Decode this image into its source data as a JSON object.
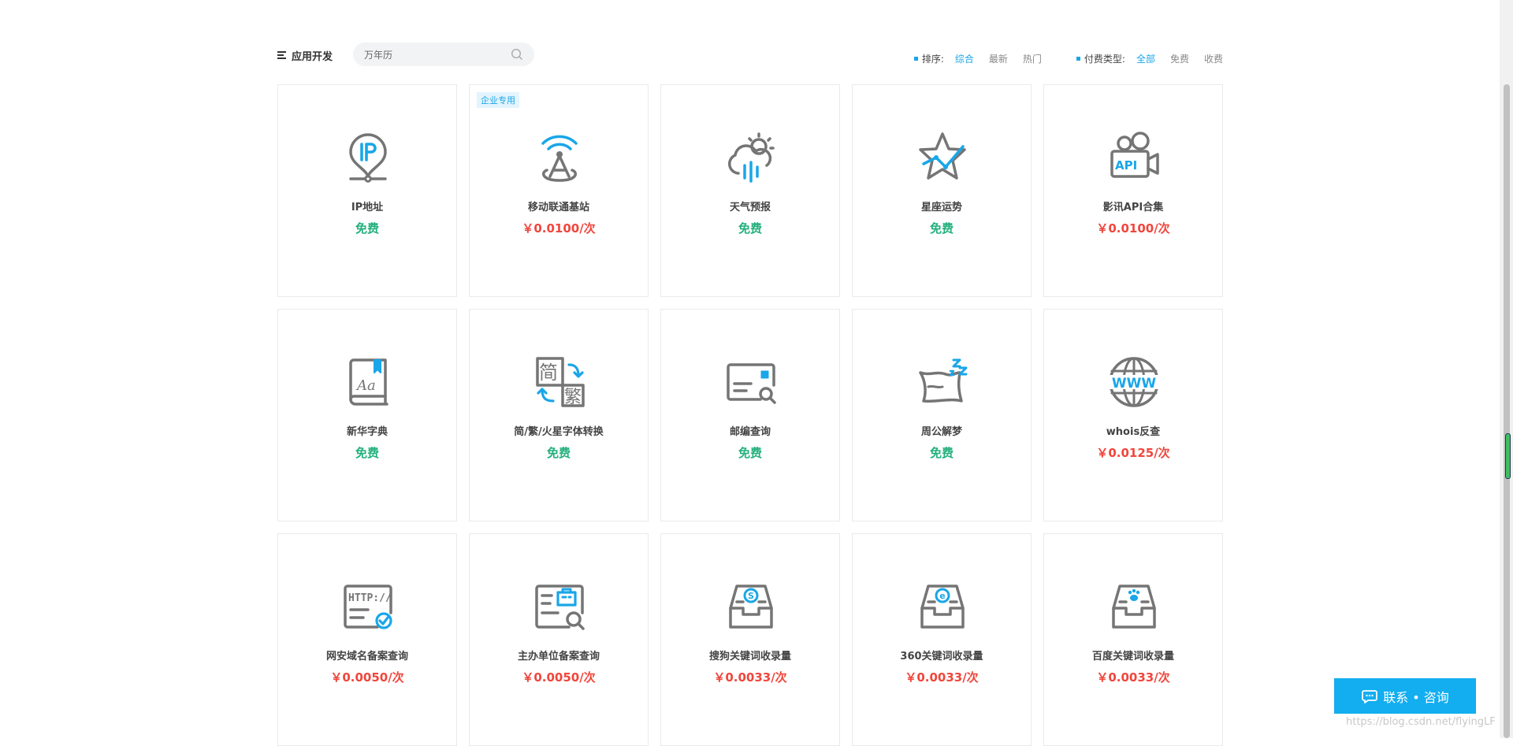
{
  "header": {
    "category_label": "应用开发",
    "search_value": "万年历",
    "sort_label": "排序:",
    "sort_options": [
      "综合",
      "最新",
      "热门"
    ],
    "pay_label": "付费类型:",
    "pay_options": [
      "全部",
      "免费",
      "收费"
    ]
  },
  "colors": {
    "accent": "#1aa6e8",
    "free": "#22b07d",
    "paid": "#f0463c",
    "icon_gray": "#757575"
  },
  "cards": [
    {
      "name": "IP地址",
      "price": "免费",
      "icon": "ip-location-icon"
    },
    {
      "name": "移动联通基站",
      "price": "￥0.0100/次",
      "badge": "企业专用",
      "icon": "base-station-icon"
    },
    {
      "name": "天气预报",
      "price": "免费",
      "icon": "weather-icon"
    },
    {
      "name": "星座运势",
      "price": "免费",
      "icon": "star-trend-icon"
    },
    {
      "name": "影讯API合集",
      "price": "￥0.0100/次",
      "icon": "camera-api-icon"
    },
    {
      "name": "新华字典",
      "price": "免费",
      "icon": "dictionary-icon"
    },
    {
      "name": "简/繁/火星字体转换",
      "price": "免费",
      "icon": "text-convert-icon"
    },
    {
      "name": "邮编查询",
      "price": "免费",
      "icon": "postcode-search-icon"
    },
    {
      "name": "周公解梦",
      "price": "免费",
      "icon": "pillow-dream-icon"
    },
    {
      "name": "whois反查",
      "price": "￥0.0125/次",
      "icon": "www-globe-icon"
    },
    {
      "name": "网安域名备案查询",
      "price": "￥0.0050/次",
      "icon": "http-check-icon"
    },
    {
      "name": "主办单位备案查询",
      "price": "￥0.0050/次",
      "icon": "organization-search-icon"
    },
    {
      "name": "搜狗关键词收录量",
      "price": "￥0.0033/次",
      "icon": "sogou-tray-icon"
    },
    {
      "name": "360关键词收录量",
      "price": "￥0.0033/次",
      "icon": "360-tray-icon"
    },
    {
      "name": "百度关键词收录量",
      "price": "￥0.0033/次",
      "icon": "baidu-tray-icon"
    }
  ],
  "consult_button": "联系 • 咨询",
  "watermark": "https://blog.csdn.net/flyingLF"
}
